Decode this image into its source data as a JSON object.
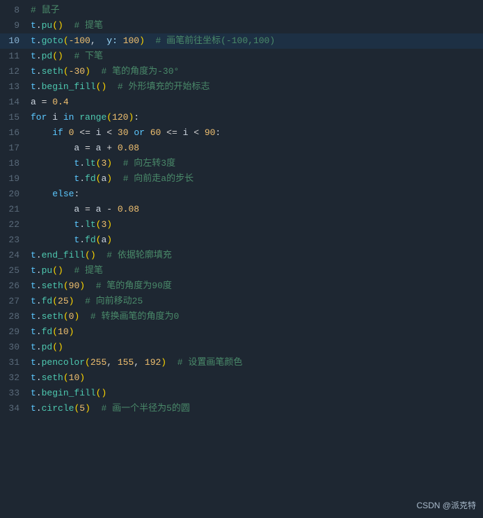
{
  "logo": "CSDN @派克特",
  "lines": [
    {
      "num": 8,
      "tokens": [
        {
          "t": "comment",
          "v": "# 鼠子"
        }
      ]
    },
    {
      "num": 9,
      "tokens": [
        {
          "t": "var",
          "v": "t"
        },
        {
          "t": "plain",
          "v": "."
        },
        {
          "t": "attr",
          "v": "pu"
        },
        {
          "t": "paren",
          "v": "()"
        },
        {
          "t": "plain",
          "v": "  "
        },
        {
          "t": "comment",
          "v": "# 提笔"
        }
      ]
    },
    {
      "num": 10,
      "tokens": [
        {
          "t": "var",
          "v": "t"
        },
        {
          "t": "plain",
          "v": "."
        },
        {
          "t": "attr",
          "v": "goto"
        },
        {
          "t": "paren",
          "v": "("
        },
        {
          "t": "num",
          "v": "-100"
        },
        {
          "t": "plain",
          "v": ",  "
        },
        {
          "t": "coord-label",
          "v": "y:"
        },
        {
          "t": "num",
          "v": " 100"
        },
        {
          "t": "paren",
          "v": ")"
        },
        {
          "t": "plain",
          "v": "  "
        },
        {
          "t": "comment",
          "v": "# 画笔前往坐标(-100,100)"
        }
      ],
      "highlight": true
    },
    {
      "num": 11,
      "tokens": [
        {
          "t": "var",
          "v": "t"
        },
        {
          "t": "plain",
          "v": "."
        },
        {
          "t": "attr",
          "v": "pd"
        },
        {
          "t": "paren",
          "v": "()"
        },
        {
          "t": "plain",
          "v": "  "
        },
        {
          "t": "comment",
          "v": "# 下笔"
        }
      ]
    },
    {
      "num": 12,
      "tokens": [
        {
          "t": "var",
          "v": "t"
        },
        {
          "t": "plain",
          "v": "."
        },
        {
          "t": "attr",
          "v": "seth"
        },
        {
          "t": "paren",
          "v": "("
        },
        {
          "t": "num",
          "v": "-30"
        },
        {
          "t": "paren",
          "v": ")"
        },
        {
          "t": "plain",
          "v": "  "
        },
        {
          "t": "comment",
          "v": "# 笔的角度为-30°"
        }
      ]
    },
    {
      "num": 13,
      "tokens": [
        {
          "t": "var",
          "v": "t"
        },
        {
          "t": "plain",
          "v": "."
        },
        {
          "t": "attr",
          "v": "begin_fill"
        },
        {
          "t": "paren",
          "v": "()"
        },
        {
          "t": "plain",
          "v": "  "
        },
        {
          "t": "comment",
          "v": "# 外形填充的开始标志"
        }
      ]
    },
    {
      "num": 14,
      "tokens": [
        {
          "t": "plain",
          "v": "a "
        },
        {
          "t": "op",
          "v": "="
        },
        {
          "t": "plain",
          "v": " "
        },
        {
          "t": "num",
          "v": "0.4"
        }
      ]
    },
    {
      "num": 15,
      "tokens": [
        {
          "t": "kw",
          "v": "for"
        },
        {
          "t": "plain",
          "v": " i "
        },
        {
          "t": "kw",
          "v": "in"
        },
        {
          "t": "plain",
          "v": " "
        },
        {
          "t": "attr",
          "v": "range"
        },
        {
          "t": "paren",
          "v": "("
        },
        {
          "t": "num",
          "v": "120"
        },
        {
          "t": "paren",
          "v": ")"
        },
        {
          "t": "plain",
          "v": ":"
        }
      ]
    },
    {
      "num": 16,
      "tokens": [
        {
          "t": "plain",
          "v": "    "
        },
        {
          "t": "kw",
          "v": "if"
        },
        {
          "t": "plain",
          "v": " "
        },
        {
          "t": "num",
          "v": "0"
        },
        {
          "t": "plain",
          "v": " "
        },
        {
          "t": "op",
          "v": "<="
        },
        {
          "t": "plain",
          "v": " i "
        },
        {
          "t": "op",
          "v": "<"
        },
        {
          "t": "plain",
          "v": " "
        },
        {
          "t": "num",
          "v": "30"
        },
        {
          "t": "plain",
          "v": " "
        },
        {
          "t": "kw",
          "v": "or"
        },
        {
          "t": "plain",
          "v": " "
        },
        {
          "t": "num",
          "v": "60"
        },
        {
          "t": "plain",
          "v": " "
        },
        {
          "t": "op",
          "v": "<="
        },
        {
          "t": "plain",
          "v": " i "
        },
        {
          "t": "op",
          "v": "<"
        },
        {
          "t": "plain",
          "v": " "
        },
        {
          "t": "num",
          "v": "90"
        },
        {
          "t": "plain",
          "v": ":"
        }
      ]
    },
    {
      "num": 17,
      "tokens": [
        {
          "t": "plain",
          "v": "        a "
        },
        {
          "t": "op",
          "v": "="
        },
        {
          "t": "plain",
          "v": " a "
        },
        {
          "t": "op",
          "v": "+"
        },
        {
          "t": "plain",
          "v": " "
        },
        {
          "t": "num",
          "v": "0.08"
        }
      ]
    },
    {
      "num": 18,
      "tokens": [
        {
          "t": "plain",
          "v": "        "
        },
        {
          "t": "var",
          "v": "t"
        },
        {
          "t": "plain",
          "v": "."
        },
        {
          "t": "attr",
          "v": "lt"
        },
        {
          "t": "paren",
          "v": "("
        },
        {
          "t": "num",
          "v": "3"
        },
        {
          "t": "paren",
          "v": ")"
        },
        {
          "t": "plain",
          "v": "  "
        },
        {
          "t": "comment",
          "v": "# 向左转3度"
        }
      ]
    },
    {
      "num": 19,
      "tokens": [
        {
          "t": "plain",
          "v": "        "
        },
        {
          "t": "var",
          "v": "t"
        },
        {
          "t": "plain",
          "v": "."
        },
        {
          "t": "attr",
          "v": "fd"
        },
        {
          "t": "paren",
          "v": "("
        },
        {
          "t": "plain",
          "v": "a"
        },
        {
          "t": "paren",
          "v": ")"
        },
        {
          "t": "plain",
          "v": "  "
        },
        {
          "t": "comment",
          "v": "# 向前走a的步长"
        }
      ]
    },
    {
      "num": 20,
      "tokens": [
        {
          "t": "plain",
          "v": "    "
        },
        {
          "t": "kw",
          "v": "else"
        },
        {
          "t": "plain",
          "v": ":"
        }
      ]
    },
    {
      "num": 21,
      "tokens": [
        {
          "t": "plain",
          "v": "        a "
        },
        {
          "t": "op",
          "v": "="
        },
        {
          "t": "plain",
          "v": " a "
        },
        {
          "t": "op",
          "v": "-"
        },
        {
          "t": "plain",
          "v": " "
        },
        {
          "t": "num",
          "v": "0.08"
        }
      ]
    },
    {
      "num": 22,
      "tokens": [
        {
          "t": "plain",
          "v": "        "
        },
        {
          "t": "var",
          "v": "t"
        },
        {
          "t": "plain",
          "v": "."
        },
        {
          "t": "attr",
          "v": "lt"
        },
        {
          "t": "paren",
          "v": "("
        },
        {
          "t": "num",
          "v": "3"
        },
        {
          "t": "paren",
          "v": ")"
        }
      ]
    },
    {
      "num": 23,
      "tokens": [
        {
          "t": "plain",
          "v": "        "
        },
        {
          "t": "var",
          "v": "t"
        },
        {
          "t": "plain",
          "v": "."
        },
        {
          "t": "attr",
          "v": "fd"
        },
        {
          "t": "paren",
          "v": "("
        },
        {
          "t": "plain",
          "v": "a"
        },
        {
          "t": "paren",
          "v": ")"
        }
      ]
    },
    {
      "num": 24,
      "tokens": [
        {
          "t": "var",
          "v": "t"
        },
        {
          "t": "plain",
          "v": "."
        },
        {
          "t": "attr",
          "v": "end_fill"
        },
        {
          "t": "paren",
          "v": "()"
        },
        {
          "t": "plain",
          "v": "  "
        },
        {
          "t": "comment",
          "v": "# 依据轮廓填充"
        }
      ]
    },
    {
      "num": 25,
      "tokens": [
        {
          "t": "var",
          "v": "t"
        },
        {
          "t": "plain",
          "v": "."
        },
        {
          "t": "attr",
          "v": "pu"
        },
        {
          "t": "paren",
          "v": "()"
        },
        {
          "t": "plain",
          "v": "  "
        },
        {
          "t": "comment",
          "v": "# 提笔"
        }
      ]
    },
    {
      "num": 26,
      "tokens": [
        {
          "t": "var",
          "v": "t"
        },
        {
          "t": "plain",
          "v": "."
        },
        {
          "t": "attr",
          "v": "seth"
        },
        {
          "t": "paren",
          "v": "("
        },
        {
          "t": "num",
          "v": "90"
        },
        {
          "t": "paren",
          "v": ")"
        },
        {
          "t": "plain",
          "v": "  "
        },
        {
          "t": "comment",
          "v": "# 笔的角度为90度"
        }
      ]
    },
    {
      "num": 27,
      "tokens": [
        {
          "t": "var",
          "v": "t"
        },
        {
          "t": "plain",
          "v": "."
        },
        {
          "t": "attr",
          "v": "fd"
        },
        {
          "t": "paren",
          "v": "("
        },
        {
          "t": "num",
          "v": "25"
        },
        {
          "t": "paren",
          "v": ")"
        },
        {
          "t": "plain",
          "v": "  "
        },
        {
          "t": "comment",
          "v": "# 向前移动25"
        }
      ]
    },
    {
      "num": 28,
      "tokens": [
        {
          "t": "var",
          "v": "t"
        },
        {
          "t": "plain",
          "v": "."
        },
        {
          "t": "attr",
          "v": "seth"
        },
        {
          "t": "paren",
          "v": "("
        },
        {
          "t": "num",
          "v": "0"
        },
        {
          "t": "paren",
          "v": ")"
        },
        {
          "t": "plain",
          "v": "  "
        },
        {
          "t": "comment",
          "v": "# 转换画笔的角度为0"
        }
      ]
    },
    {
      "num": 29,
      "tokens": [
        {
          "t": "var",
          "v": "t"
        },
        {
          "t": "plain",
          "v": "."
        },
        {
          "t": "attr",
          "v": "fd"
        },
        {
          "t": "paren",
          "v": "("
        },
        {
          "t": "num",
          "v": "10"
        },
        {
          "t": "paren",
          "v": ")"
        }
      ]
    },
    {
      "num": 30,
      "tokens": [
        {
          "t": "var",
          "v": "t"
        },
        {
          "t": "plain",
          "v": "."
        },
        {
          "t": "attr",
          "v": "pd"
        },
        {
          "t": "paren",
          "v": "()"
        }
      ]
    },
    {
      "num": 31,
      "tokens": [
        {
          "t": "var",
          "v": "t"
        },
        {
          "t": "plain",
          "v": "."
        },
        {
          "t": "attr",
          "v": "pencolor"
        },
        {
          "t": "paren",
          "v": "("
        },
        {
          "t": "num",
          "v": "255"
        },
        {
          "t": "plain",
          "v": ", "
        },
        {
          "t": "num",
          "v": "155"
        },
        {
          "t": "plain",
          "v": ", "
        },
        {
          "t": "num",
          "v": "192"
        },
        {
          "t": "paren",
          "v": ")"
        },
        {
          "t": "plain",
          "v": "  "
        },
        {
          "t": "comment",
          "v": "# 设置画笔颜色"
        }
      ]
    },
    {
      "num": 32,
      "tokens": [
        {
          "t": "var",
          "v": "t"
        },
        {
          "t": "plain",
          "v": "."
        },
        {
          "t": "attr",
          "v": "seth"
        },
        {
          "t": "paren",
          "v": "("
        },
        {
          "t": "num",
          "v": "10"
        },
        {
          "t": "paren",
          "v": ")"
        }
      ]
    },
    {
      "num": 33,
      "tokens": [
        {
          "t": "var",
          "v": "t"
        },
        {
          "t": "plain",
          "v": "."
        },
        {
          "t": "attr",
          "v": "begin_fill"
        },
        {
          "t": "paren",
          "v": "()"
        }
      ]
    },
    {
      "num": 34,
      "tokens": [
        {
          "t": "var",
          "v": "t"
        },
        {
          "t": "plain",
          "v": "."
        },
        {
          "t": "attr",
          "v": "circle"
        },
        {
          "t": "paren",
          "v": "("
        },
        {
          "t": "num",
          "v": "5"
        },
        {
          "t": "paren",
          "v": ")"
        },
        {
          "t": "plain",
          "v": "  "
        },
        {
          "t": "comment",
          "v": "# 画一个半径为5的圆"
        }
      ]
    }
  ]
}
